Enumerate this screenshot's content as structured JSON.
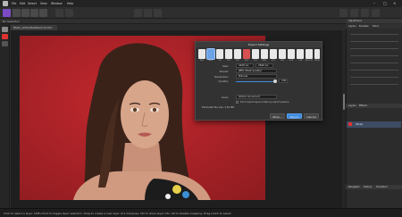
{
  "menubar": {
    "items": [
      "File",
      "Edit",
      "Select",
      "View",
      "Window",
      "Help"
    ]
  },
  "contextbar": {
    "label": "No Selection"
  },
  "document": {
    "tab_label": "Photo_1234 [Modified] (13.4%)"
  },
  "dialog": {
    "title": "Export Settings",
    "formats": [
      "PNG",
      "JPEG",
      "GIF",
      "TIFF",
      "PSD",
      "PDF",
      "SVG",
      "WMF",
      "EPS",
      "EXR",
      "HDR",
      "TGA",
      "JPEG XR",
      "WEBP"
    ],
    "selected_format": "JPEG",
    "size_label": "Size:",
    "width": "4160 px",
    "height": "2640 px",
    "preset_label": "Preset:",
    "preset": "JPEG (Best quality)",
    "resample_label": "Resample:",
    "resample": "Bilinear",
    "quality_label": "Quality:",
    "quality": "100",
    "area_label": "Area:",
    "area": "Whole document",
    "checkbox_label": "Don't export layers hidden by export persona",
    "estimate": "Estimated file size: 3.65 MB",
    "buttons": {
      "more": "More...",
      "export": "Export",
      "cancel": "Cancel"
    }
  },
  "panels": {
    "top_tabs": [
      "Layers",
      "Brushes",
      "Stock"
    ],
    "top_title": "Adjustment",
    "layers_tabs": [
      "Layers",
      "Effects"
    ],
    "layer_name": "(Pixel)",
    "bottom_tabs": [
      "Navigator",
      "History",
      "Transform"
    ]
  },
  "statusbar": {
    "text": "Click to select a layer. Shift+Click to toggle layer selection. Drag to create a new layer of a marquee. Ctrl to show layer info. Alt to disable snapping. Drag+Click to select"
  },
  "colors": {
    "photo_background": "#b7262b",
    "accent": "#3c8be0"
  }
}
